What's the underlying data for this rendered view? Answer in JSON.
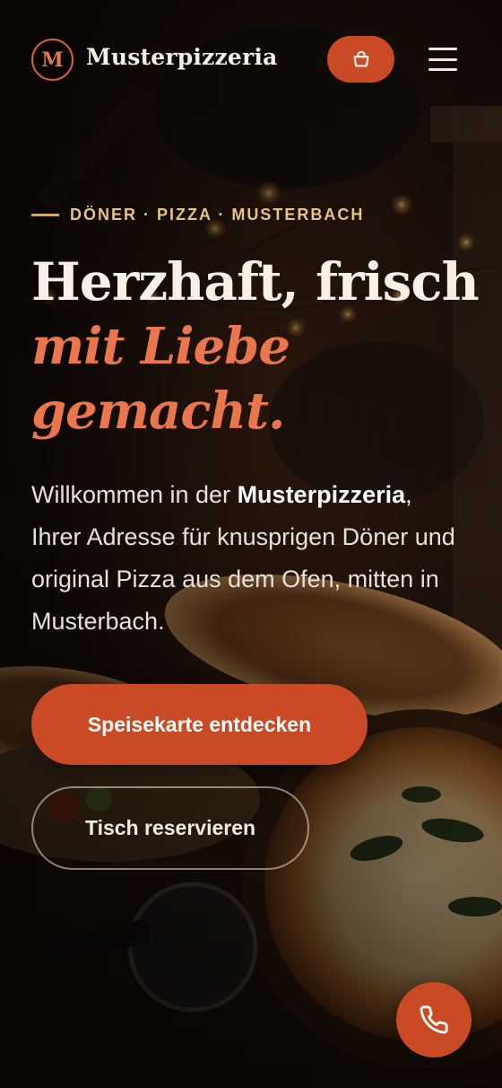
{
  "header": {
    "logo_letter": "M",
    "brand_name": "Musterpizzeria",
    "cart_icon": "shopping-basket-icon",
    "menu_icon": "hamburger-menu-icon"
  },
  "hero": {
    "eyebrow": "DÖNER · PIZZA · MUSTERBACH",
    "headline_line1": "Herzhaft, frisch",
    "headline_accent_line1": "mit Liebe",
    "headline_accent_line2": "gemacht.",
    "intro_prefix": "Willkommen in der ",
    "intro_brand": "Musterpizzeria",
    "intro_suffix": ", Ihrer Adresse für knusprigen Döner und original Pizza aus dem Ofen, mitten in Musterbach.",
    "cta_primary": "Speisekarte entdecken",
    "cta_secondary": "Tisch reservieren"
  },
  "fab": {
    "call_icon": "phone-icon"
  },
  "colors": {
    "accent": "#c94a24",
    "accent_text": "#e9764c",
    "eyebrow": "#e7c488",
    "background": "#1a0f09"
  }
}
